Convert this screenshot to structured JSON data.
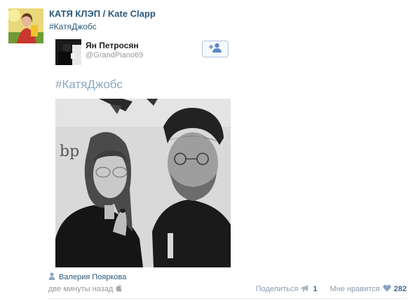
{
  "post": {
    "author": "КАТЯ КЛЭП / Kate Clapp",
    "hashtag": "#КатяДжобс"
  },
  "quote": {
    "name": "Ян Петросян",
    "handle": "@GrandPiano69"
  },
  "content": {
    "hashtag": "#КатяДжобс"
  },
  "photo_credit": {
    "name": "Валерия Пояркова"
  },
  "meta": {
    "time": "две минуты назад"
  },
  "actions": {
    "share_label": "Поделиться",
    "share_count": "1",
    "like_label": "Мне нравится",
    "like_count": "282"
  },
  "colors": {
    "link": "#2b587a",
    "muted": "#999999",
    "action": "#8b9bb0",
    "accent": "#45668e"
  },
  "icons": {
    "follow": "add-user-icon",
    "person": "person-icon",
    "device": "apple-icon",
    "share": "megaphone-icon",
    "like": "heart-icon"
  }
}
